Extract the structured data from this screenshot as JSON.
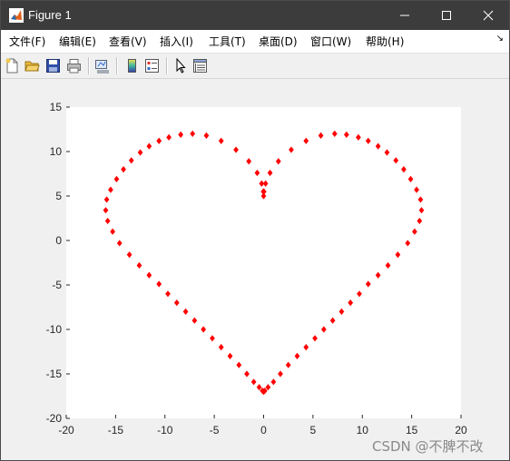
{
  "window": {
    "title": "Figure 1"
  },
  "menu": {
    "items": [
      "文件(F)",
      "编辑(E)",
      "查看(V)",
      "插入(I)",
      "工具(T)",
      "桌面(D)",
      "窗口(W)",
      "帮助(H)"
    ]
  },
  "toolbar": {
    "icons": [
      "new-figure-icon",
      "open-file-icon",
      "save-icon",
      "print-icon",
      "link-plot-icon",
      "insert-colorbar-icon",
      "insert-legend-icon",
      "edit-plot-icon",
      "property-inspector-icon"
    ]
  },
  "watermark": "CSDN @不脾不改",
  "colors": {
    "marker": "#ff0000",
    "axes_bg": "#ffffff",
    "figure_bg": "#f0f0f0"
  },
  "chart_data": {
    "type": "scatter",
    "marker": "diamond",
    "marker_color": "#ff0000",
    "title": "",
    "xlabel": "",
    "ylabel": "",
    "xlim": [
      -20,
      20
    ],
    "ylim": [
      -20,
      15
    ],
    "xticks": [
      -20,
      -15,
      -10,
      -5,
      0,
      5,
      10,
      15,
      20
    ],
    "yticks": [
      -20,
      -15,
      -10,
      -5,
      0,
      5,
      10,
      15
    ],
    "grid": false,
    "x": [
      0,
      0.03,
      0.2,
      0.65,
      1.5,
      2.8,
      4.3,
      5.8,
      7.2,
      8.4,
      9.6,
      10.6,
      11.6,
      12.5,
      13.4,
      14.2,
      14.9,
      15.5,
      15.9,
      16.0,
      15.8,
      15.3,
      14.6,
      13.6,
      12.6,
      11.6,
      10.6,
      9.7,
      8.8,
      7.9,
      7.0,
      6.1,
      5.2,
      4.3,
      3.4,
      2.5,
      1.7,
      1.0,
      0.45,
      0.12,
      0,
      -0.12,
      -0.45,
      -1.0,
      -1.7,
      -2.5,
      -3.4,
      -4.3,
      -5.2,
      -6.1,
      -7.0,
      -7.9,
      -8.8,
      -9.7,
      -10.6,
      -11.6,
      -12.6,
      -13.6,
      -14.6,
      -15.3,
      -15.8,
      -16.0,
      -15.9,
      -15.5,
      -14.9,
      -14.2,
      -13.4,
      -12.5,
      -11.6,
      -10.6,
      -9.6,
      -8.4,
      -7.2,
      -5.8,
      -4.3,
      -2.8,
      -1.5,
      -0.65,
      -0.2,
      -0.03
    ],
    "y": [
      5.0,
      5.5,
      6.4,
      7.6,
      8.9,
      10.2,
      11.2,
      11.8,
      12.0,
      11.9,
      11.6,
      11.2,
      10.6,
      9.9,
      9.0,
      8.0,
      6.9,
      5.7,
      4.6,
      3.4,
      2.2,
      1.0,
      -0.3,
      -1.6,
      -2.8,
      -3.9,
      -4.9,
      -6.0,
      -7.0,
      -8.0,
      -9.0,
      -10.0,
      -11.0,
      -12.0,
      -13.0,
      -14.0,
      -15.0,
      -15.9,
      -16.5,
      -16.9,
      -17.0,
      -16.9,
      -16.5,
      -15.9,
      -15.0,
      -14.0,
      -13.0,
      -12.0,
      -11.0,
      -10.0,
      -9.0,
      -8.0,
      -7.0,
      -6.0,
      -4.9,
      -3.9,
      -2.8,
      -1.6,
      -0.3,
      1.0,
      2.2,
      3.4,
      4.6,
      5.7,
      6.9,
      8.0,
      9.0,
      9.9,
      10.6,
      11.2,
      11.6,
      11.9,
      12.0,
      11.8,
      11.2,
      10.2,
      8.9,
      7.6,
      6.4,
      5.5
    ]
  }
}
